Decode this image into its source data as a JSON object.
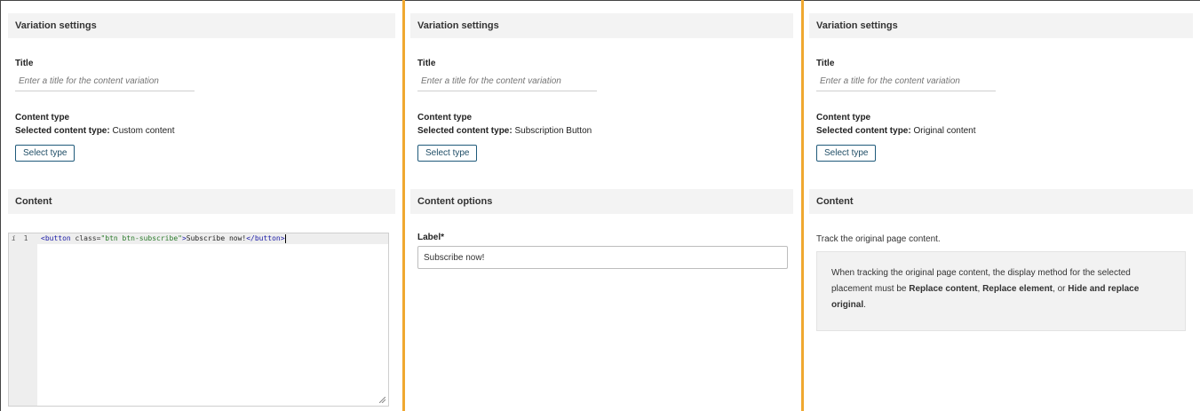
{
  "panels": [
    {
      "header": "Variation settings",
      "title_label": "Title",
      "title_placeholder": "Enter a title for the content variation",
      "content_type_label": "Content type",
      "selected_prefix": "Selected content type:",
      "selected_value": "Custom content",
      "select_button": "Select type",
      "section2_header": "Content",
      "code": {
        "line_marker": "i",
        "line_number": "1",
        "open_tag": "<button",
        "attr_name": " class=",
        "attr_value": "\"btn btn-subscribe\"",
        "open_close": ">",
        "text": "Subscribe now!",
        "close_tag": "</button>"
      }
    },
    {
      "header": "Variation settings",
      "title_label": "Title",
      "title_placeholder": "Enter a title for the content variation",
      "content_type_label": "Content type",
      "selected_prefix": "Selected content type:",
      "selected_value": "Subscription Button",
      "select_button": "Select type",
      "section2_header": "Content options",
      "label_field": "Label*",
      "label_value": "Subscribe now!"
    },
    {
      "header": "Variation settings",
      "title_label": "Title",
      "title_placeholder": "Enter a title for the content variation",
      "content_type_label": "Content type",
      "selected_prefix": "Selected content type:",
      "selected_value": "Original content",
      "select_button": "Select type",
      "section2_header": "Content",
      "track_text": "Track the original page content.",
      "info": {
        "part1": "When tracking the original page content, the display method for the selected placement must be ",
        "opt1": "Replace content",
        "sep1": ", ",
        "opt2": "Replace element",
        "sep2": ", or ",
        "opt3": "Hide and replace original",
        "end": "."
      }
    }
  ],
  "colors": {
    "divider": "#f0a830",
    "header_bg": "#f3f3f3",
    "button_border": "#1f5a7a"
  }
}
